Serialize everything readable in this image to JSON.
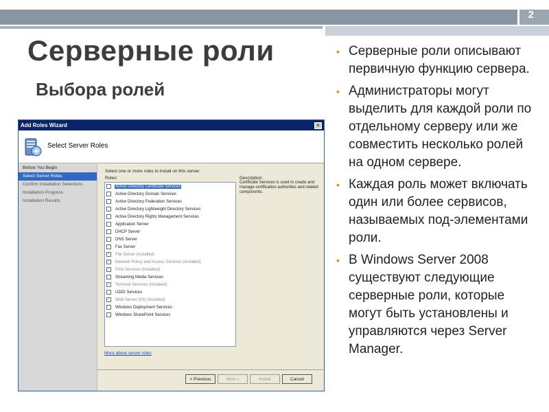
{
  "slide": {
    "page_number": "2",
    "title": "Серверные роли",
    "subtitle": "Выбора ролей"
  },
  "bullets": [
    "Серверные роли описывают первичную функцию сервера.",
    "Администраторы могут выделить для каждой роли по отдельному серверу или же совместить несколько ролей на одном сервере.",
    "Каждая роль может включать один или более сервисов, называемых под-элементами роли.",
    "В Windows Server 2008 существуют следующие серверные роли, которые могут быть установлены и управляются через Server Manager."
  ],
  "wizard": {
    "window_title": "Add Roles Wizard",
    "close_label": "×",
    "header_title": "Select Server Roles",
    "nav": [
      {
        "label": "Before You Begin",
        "state": "normal"
      },
      {
        "label": "Select Server Roles",
        "state": "active"
      },
      {
        "label": "Confirm Installation Selections",
        "state": "disabled"
      },
      {
        "label": "Installation Progress",
        "state": "disabled"
      },
      {
        "label": "Installation Results",
        "state": "disabled"
      }
    ],
    "instruction": "Select one or more roles to install on this server.",
    "roles_label": "Roles:",
    "roles": [
      {
        "label": "Active Directory Certificate Services",
        "checked": false,
        "installed": false,
        "selected": true
      },
      {
        "label": "Active Directory Domain Services",
        "checked": false,
        "installed": false,
        "selected": false
      },
      {
        "label": "Active Directory Federation Services",
        "checked": false,
        "installed": false,
        "selected": false
      },
      {
        "label": "Active Directory Lightweight Directory Services",
        "checked": false,
        "installed": false,
        "selected": false
      },
      {
        "label": "Active Directory Rights Management Services",
        "checked": false,
        "installed": false,
        "selected": false
      },
      {
        "label": "Application Server",
        "checked": false,
        "installed": false,
        "selected": false
      },
      {
        "label": "DHCP Server",
        "checked": false,
        "installed": false,
        "selected": false
      },
      {
        "label": "DNS Server",
        "checked": false,
        "installed": false,
        "selected": false
      },
      {
        "label": "Fax Server",
        "checked": false,
        "installed": false,
        "selected": false
      },
      {
        "label": "File Server  (Installed)",
        "checked": true,
        "installed": true,
        "selected": false
      },
      {
        "label": "Network Policy and Access Services  (Installed)",
        "checked": true,
        "installed": true,
        "selected": false
      },
      {
        "label": "Print Services  (Installed)",
        "checked": true,
        "installed": true,
        "selected": false
      },
      {
        "label": "Streaming Media Services",
        "checked": false,
        "installed": false,
        "selected": false
      },
      {
        "label": "Terminal Services  (Installed)",
        "checked": true,
        "installed": true,
        "selected": false
      },
      {
        "label": "UDDI Services",
        "checked": false,
        "installed": false,
        "selected": false
      },
      {
        "label": "Web Server (IIS)  (Installed)",
        "checked": true,
        "installed": true,
        "selected": false
      },
      {
        "label": "Windows Deployment Services",
        "checked": false,
        "installed": false,
        "selected": false
      },
      {
        "label": "Windows SharePoint Services",
        "checked": false,
        "installed": false,
        "selected": false
      }
    ],
    "description_label": "Description:",
    "description_text": "Certificate Services is used to create and manage certification authorities and related components.",
    "more_link": "More about server roles",
    "buttons": {
      "previous": "< Previous",
      "next": "Next >",
      "install": "Install",
      "cancel": "Cancel"
    }
  },
  "colors": {
    "accent_bullet": "#e08a1e",
    "selection": "#316ac5",
    "titlebar": "#0a246a"
  }
}
